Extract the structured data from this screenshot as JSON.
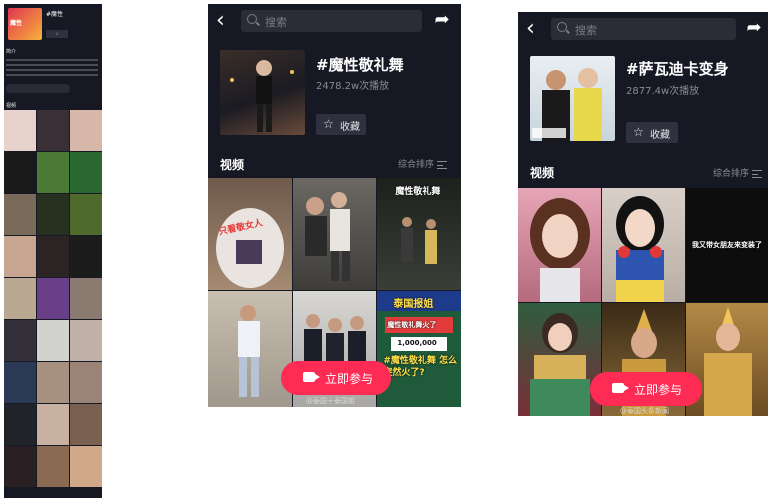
{
  "p1": {
    "title": "#魔性",
    "cover_text": "魔性",
    "section_intro": "简介",
    "section_videos": "视频"
  },
  "p2": {
    "search_placeholder": "搜索",
    "hashtag": "#魔性敬礼舞",
    "plays": "2478.2w次播放",
    "collect_label": "收藏",
    "videos_title": "视频",
    "sort_label": "综合排序",
    "join_label": "立即参与",
    "watermark": "@泰国十泰国姐",
    "tiles": [
      {
        "caption": "只看敬女人",
        "color": "#8a6f5b"
      },
      {
        "caption": "",
        "color": "#5e5c58"
      },
      {
        "caption": "魔性敬礼舞",
        "color": "#2a2f2a"
      },
      {
        "caption": "",
        "color": "#b8b2a6"
      },
      {
        "caption": "",
        "color": "#c9c6c0"
      },
      {
        "caption": "泰国报姐",
        "color": "#1f5a3a"
      }
    ],
    "news_tile": {
      "sub": "魔性敬礼舞火了",
      "count": "1,000,000",
      "bottom": "#魔性敬礼舞 怎么突然火了?"
    }
  },
  "p3": {
    "search_placeholder": "搜索",
    "hashtag": "#萨瓦迪卡变身",
    "plays": "2877.4w次播放",
    "collect_label": "收藏",
    "videos_title": "视频",
    "sort_label": "综合排序",
    "join_label": "立即参与",
    "watermark": "@泰国头条新闻",
    "tiles": [
      {
        "caption": "",
        "color": "#d98b9e"
      },
      {
        "caption": "",
        "color": "#3f6fb0"
      },
      {
        "caption": "我又带女朋友来变装了",
        "color": "#0d0d0d"
      },
      {
        "caption": "",
        "color": "#3b6a4a"
      },
      {
        "caption": "",
        "color": "#6b5a3a"
      },
      {
        "caption": "",
        "color": "#b5893e"
      }
    ]
  },
  "colors": {
    "bg": "#161823",
    "accent": "#fe2c55"
  }
}
